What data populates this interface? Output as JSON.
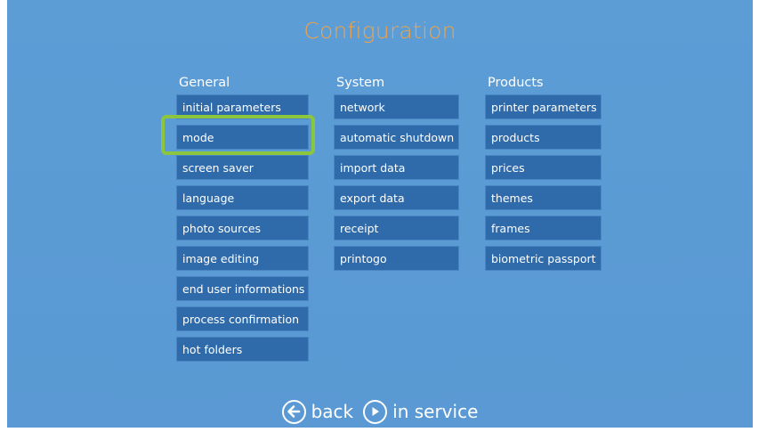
{
  "title": "Configuration",
  "columns": {
    "general": {
      "heading": "General",
      "items": [
        "initial parameters",
        "mode",
        "screen saver",
        "language",
        "photo sources",
        "image editing",
        "end user informations",
        "process confirmation",
        "hot folders"
      ]
    },
    "system": {
      "heading": "System",
      "items": [
        "network",
        "automatic shutdown",
        "import data",
        "export data",
        "receipt",
        "printogo"
      ]
    },
    "products": {
      "heading": "Products",
      "items": [
        "printer parameters",
        "products",
        "prices",
        "themes",
        "frames",
        "biometric passport"
      ]
    }
  },
  "highlighted_item": "mode",
  "footer": {
    "back_label": "back",
    "in_service_label": "in service",
    "back_icon": "arrow-left-circle-icon",
    "in_service_icon": "play-circle-icon"
  },
  "colors": {
    "background": "#5b9bd5",
    "button": "#2f6bab",
    "title": "#f0a34a",
    "highlight": "#8cc63f"
  }
}
